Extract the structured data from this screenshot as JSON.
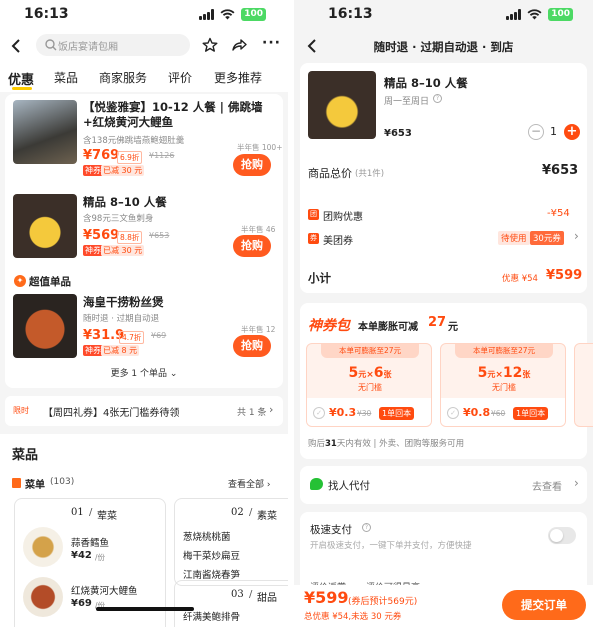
{
  "left": {
    "time": "16:13",
    "battery": "100",
    "search_placeholder": "饭店宴请包厢",
    "tabs": [
      "优惠",
      "菜品",
      "商家服务",
      "评价",
      "更多推荐"
    ],
    "deals": [
      {
        "title": "【悦鉴雅宴】10-12 人餐 | 佛跳墙+红烧黄河大鲤鱼",
        "desc": "含138元佛跳墙燕鲍翅肚羹",
        "price": "¥769",
        "discount": "6.9折",
        "orig": "¥1126",
        "tag": "神券",
        "saved": "已减 30 元",
        "sales": "半年售 100+",
        "btn": "抢购"
      },
      {
        "title": "精品 8–10 人餐",
        "desc": "含98元三文鱼刺身",
        "price": "¥569",
        "discount": "8.8折",
        "orig": "¥653",
        "tag": "神券",
        "saved": "已减 30 元",
        "sales": "半年售 46",
        "btn": "抢购"
      }
    ],
    "special_header": "超值单品",
    "single": {
      "title": "海皇干捞粉丝煲",
      "desc": "随时退 · 过期自动退",
      "price": "¥31.9",
      "rating": "4.7折",
      "orig": "¥69",
      "tag": "神券",
      "saved": "已减 8 元",
      "sales": "半年售 12",
      "btn": "抢购"
    },
    "more": "更多 1 个单品",
    "coupon_tag": "限时",
    "coupon_text": "【周四礼券】4张无门槛券待领",
    "coupon_count": "共 1 条",
    "dishes_title": "菜品",
    "menu_label": "菜单",
    "menu_count": "(103)",
    "see_all": "查看全部",
    "cat1_num": "01",
    "cat1_name": "荤菜",
    "cat1_items": [
      {
        "name": "蒜香鳕鱼",
        "price": "¥42",
        "unit": "/份"
      },
      {
        "name": "红烧黄河大鲤鱼",
        "price": "¥69",
        "unit": "/份"
      }
    ],
    "cat2_num": "02",
    "cat2_name": "素菜",
    "cat2_items": [
      "葱烧桃桃菌",
      "梅干菜炒扁豆",
      "江南酱烧春笋"
    ],
    "cat3_num": "03",
    "cat3_name": "甜品",
    "cat3_partial": "纤满美鲍排骨"
  },
  "right": {
    "time": "16:13",
    "battery": "100",
    "nav_title": "随时退 · 过期自动退 · 到店",
    "product": {
      "name": "精品 8–10 人餐",
      "sub": "周一至周日",
      "price": "¥653",
      "qty": "1"
    },
    "total_label": "商品总价",
    "total_count": "(共1件)",
    "total_value": "¥653",
    "group_label": "团购优惠",
    "group_value": "-¥54",
    "group_icon": "团",
    "mt_label": "美团券",
    "mt_icon": "券",
    "mt_status": "待使用",
    "mt_coupon": "30元券",
    "subtotal_label": "小计",
    "subtotal_prefix": "优惠 ¥54",
    "subtotal_value": "¥599",
    "pack_title": "神券包",
    "pack_sub": "本单膨胀可减",
    "pack_amount": "27",
    "pack_unit": "元",
    "pack_cards": [
      {
        "head": "本单可膨胀至27元",
        "value": "5",
        "unit": "元",
        "x": "×",
        "count": "6",
        "count_unit": "张",
        "cond": "无门槛",
        "price": "¥0.3",
        "orig": "¥30",
        "badge": "1单回本"
      },
      {
        "head": "本单可膨胀至27元",
        "value": "5",
        "unit": "元",
        "x": "×",
        "count": "12",
        "count_unit": "张",
        "cond": "无门槛",
        "price": "¥0.8",
        "orig": "¥60",
        "badge": "1单回本"
      }
    ],
    "pack_note_1": "购后",
    "pack_note_days": "31",
    "pack_note_2": "天内有效 | 外卖、团购等服务可用",
    "help_label": "找人代付",
    "help_link": "去查看",
    "fast_label": "极速支付",
    "fast_desc": "开启极速支付，一键下单并支付，方便快捷",
    "partial_row": "评价返赏 · · · 评价可得最高",
    "bottom_price": "¥599",
    "bottom_est": "(券后预计569元)",
    "bottom_detail": "总优惠 ¥54,未选 30 元券",
    "submit": "提交订单",
    "colors": {
      "accent": "#ff4b10",
      "button": "#ff6a1a",
      "green": "#25c135"
    }
  }
}
